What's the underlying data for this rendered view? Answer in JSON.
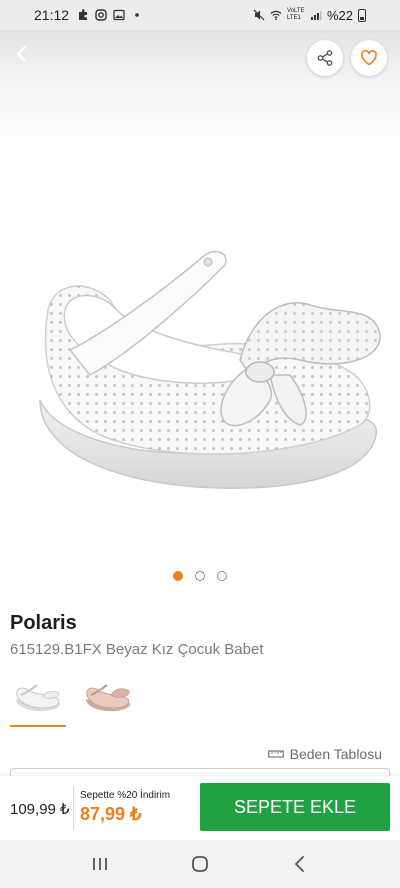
{
  "status_bar": {
    "time": "21:12",
    "network": "VoLTE LTE1",
    "battery": "%22"
  },
  "header": {
    "back_icon": "chevron-left-icon",
    "share_icon": "share-icon",
    "favorite_icon": "heart-icon"
  },
  "carousel": {
    "total": 3,
    "active_index": 0
  },
  "product": {
    "brand": "Polaris",
    "name": "615129.B1FX Beyaz Kız Çocuk Babet",
    "variants": [
      {
        "color": "white",
        "selected": true
      },
      {
        "color": "pink",
        "selected": false
      }
    ]
  },
  "size_table": {
    "label": "Beden Tablosu",
    "icon": "ruler-icon"
  },
  "purchase": {
    "old_price": "109,99 ₺",
    "discount_label": "Sepette %20 İndirim",
    "new_price": "87,99 ₺",
    "add_to_cart": "SEPETE EKLE"
  },
  "colors": {
    "accent": "#f07d1e",
    "cart_button": "#20a243"
  },
  "nav_bar": {
    "items": [
      "recents-icon",
      "home-icon",
      "back-icon"
    ]
  }
}
